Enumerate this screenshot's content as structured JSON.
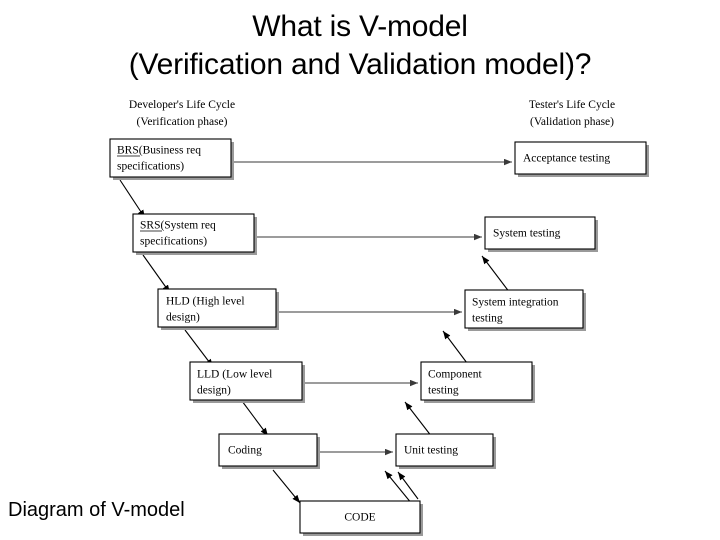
{
  "slide": {
    "title_line1": "What is V-model",
    "title_line2": "(Verification and Validation model)?",
    "caption": "Diagram of V-model",
    "background_color": "#ffffff",
    "text_color": "#000000"
  },
  "diagram": {
    "left_header": {
      "line1": "Developer's Life Cycle",
      "line2": "(Verification phase)"
    },
    "right_header": {
      "line1": "Tester's Life Cycle",
      "line2": "(Validation phase)"
    },
    "left_boxes": [
      {
        "line1": "BRS(Business req",
        "line2": "specifications)",
        "underline": "BRS"
      },
      {
        "line1": "SRS(System req",
        "line2": "specifications)",
        "underline": "SRS"
      },
      {
        "line1": "HLD (High level",
        "line2": "design)",
        "underline": ""
      },
      {
        "line1": "LLD (Low level",
        "line2": "design)",
        "underline": ""
      },
      {
        "line1": "Coding",
        "line2": "",
        "underline": ""
      }
    ],
    "right_boxes": [
      {
        "line1": "Acceptance testing",
        "line2": ""
      },
      {
        "line1": "System testing",
        "line2": ""
      },
      {
        "line1": "System integration",
        "line2": "testing"
      },
      {
        "line1": "Component",
        "line2": "testing"
      },
      {
        "line1": "Unit testing",
        "line2": ""
      }
    ],
    "bottom_box": {
      "line1": "CODE"
    },
    "connector_color": "#3a3a3a",
    "box_border_color": "#000000"
  }
}
